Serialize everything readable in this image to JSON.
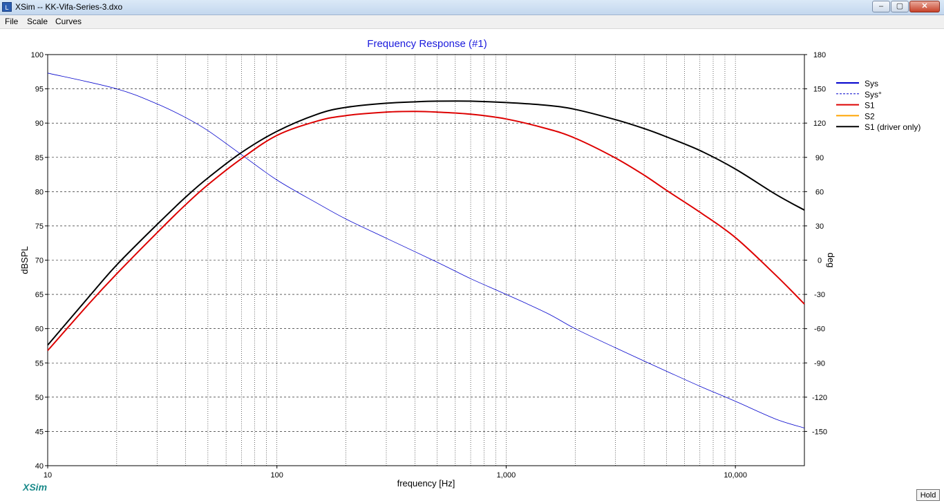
{
  "window": {
    "title": "XSim -- KK-Vifa-Series-3.dxo",
    "icon": "xsim-app-icon",
    "minimize_label": "–",
    "maximize_label": "▢",
    "close_label": "✕"
  },
  "menu": {
    "items": [
      "File",
      "Scale",
      "Curves"
    ]
  },
  "footer": {
    "brand": "XSim",
    "hold_label": "Hold"
  },
  "chart_data": {
    "type": "line",
    "title": "Frequency Response (#1)",
    "xlabel": "frequency [Hz]",
    "ylabel": "dBSPL",
    "y2label": "deg",
    "x_scale": "log",
    "xlim": [
      10,
      20000
    ],
    "ylim": [
      40,
      100
    ],
    "y2lim": [
      -180,
      180
    ],
    "x_ticks": [
      {
        "value": 10,
        "label": "10"
      },
      {
        "value": 100,
        "label": "100"
      },
      {
        "value": 1000,
        "label": "1,000"
      },
      {
        "value": 10000,
        "label": "10,000"
      }
    ],
    "y_ticks": [
      100,
      95,
      90,
      85,
      80,
      75,
      70,
      65,
      60,
      55,
      50,
      45,
      40
    ],
    "y2_ticks": [
      180,
      150,
      120,
      90,
      60,
      30,
      0,
      -30,
      -60,
      -90,
      -120,
      -150
    ],
    "grid": true,
    "legend_position": "right",
    "legend": [
      {
        "name": "Sys",
        "color": "#0000cc",
        "style": "solid"
      },
      {
        "name": "Sys°",
        "color": "#0000cc",
        "style": "dashed"
      },
      {
        "name": "S1",
        "color": "#dd0000",
        "style": "solid"
      },
      {
        "name": "S2",
        "color": "#ffa500",
        "style": "solid"
      },
      {
        "name": "S1 (driver only)",
        "color": "#000000",
        "style": "solid"
      }
    ],
    "series": [
      {
        "name": "Sys",
        "axis": "left",
        "color": "#0000cc",
        "width": 0.8,
        "x": [
          10,
          20,
          30,
          40,
          50,
          70,
          100,
          150,
          200,
          300,
          500,
          700,
          1000,
          1500,
          2000,
          3000,
          5000,
          7000,
          10000,
          15000,
          20000
        ],
        "y": [
          97.3,
          95.0,
          92.8,
          90.8,
          88.9,
          85.4,
          81.7,
          78.3,
          76.0,
          73.2,
          69.7,
          67.3,
          65.0,
          62.3,
          60.0,
          57.2,
          53.8,
          51.6,
          49.4,
          46.8,
          45.5
        ]
      },
      {
        "name": "Sys°",
        "axis": "right",
        "color": "#0000cc",
        "style": "dashed",
        "x": [],
        "y": []
      },
      {
        "name": "S1",
        "axis": "left",
        "color": "#dd0000",
        "width": 2,
        "x": [
          10,
          15,
          20,
          30,
          40,
          50,
          70,
          100,
          150,
          200,
          300,
          400,
          500,
          700,
          1000,
          1500,
          2000,
          3000,
          4000,
          5000,
          7000,
          10000,
          15000,
          20000
        ],
        "y": [
          56.8,
          63.5,
          68.0,
          74.0,
          78.1,
          81.0,
          84.8,
          88.2,
          90.3,
          91.1,
          91.6,
          91.7,
          91.6,
          91.3,
          90.6,
          89.2,
          87.8,
          84.9,
          82.4,
          80.2,
          77.0,
          73.3,
          67.8,
          63.6
        ]
      },
      {
        "name": "S2",
        "axis": "left",
        "color": "#ffa500",
        "x": [],
        "y": []
      },
      {
        "name": "S1 (driver only)",
        "axis": "left",
        "color": "#000000",
        "width": 2,
        "x": [
          10,
          15,
          20,
          30,
          40,
          50,
          70,
          100,
          150,
          200,
          300,
          400,
          500,
          700,
          1000,
          1500,
          2000,
          3000,
          4000,
          5000,
          7000,
          10000,
          15000,
          20000
        ],
        "y": [
          57.6,
          64.5,
          69.3,
          75.2,
          79.2,
          82.0,
          85.7,
          88.8,
          91.3,
          92.3,
          92.9,
          93.1,
          93.2,
          93.2,
          93.0,
          92.6,
          92.0,
          90.5,
          89.2,
          88.0,
          86.0,
          83.3,
          79.6,
          77.3
        ]
      }
    ]
  }
}
